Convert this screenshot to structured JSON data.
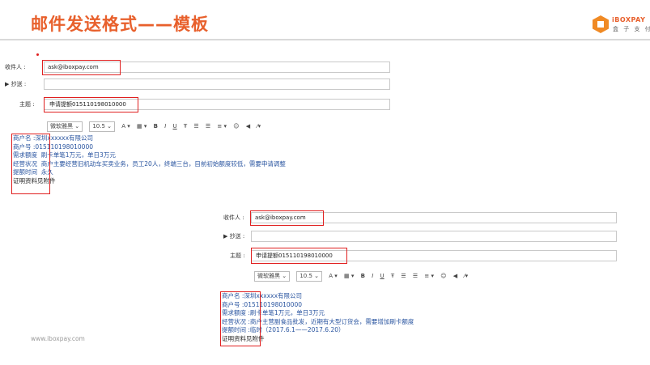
{
  "header": {
    "title": "邮件发送格式——模板",
    "logo_text": "iBOXPAY",
    "logo_sub": "盒 子 支 付"
  },
  "email1": {
    "to_label": "收件人 :",
    "to_value": "ask@iboxpay.com",
    "cc_label": "▶ 抄送 :",
    "subject_label": "主题 :",
    "subject_value": "申请提额015110198010000",
    "toolbar": {
      "font": "微软雅黑",
      "size": "10.5",
      "buttons": [
        "A ▾",
        "▦ ▾",
        "B",
        "I",
        "U",
        "Ŧ",
        "☰",
        "☰",
        "≡ ▾",
        "☺",
        "◀",
        "⁄▾"
      ]
    },
    "body": {
      "lines": [
        {
          "key": "商户名 :",
          "val": "深圳xxxxxx有限公司"
        },
        {
          "key": "商户号 :",
          "val": "015110198010000"
        },
        {
          "key": "需求额度",
          "val": "刷卡单笔1万元，单日3万元"
        },
        {
          "key": "经营状况",
          "val": "商户主要经营旧机动车买卖业务，员工20人，终端三台，目前初始额度较低，需要申请调整"
        },
        {
          "key": "提额时间",
          "val": "永久"
        }
      ],
      "footer": "证明资料见附件"
    }
  },
  "email2": {
    "to_label": "收件人 :",
    "to_value": "ask@iboxpay.com",
    "cc_label": "▶ 抄送 :",
    "subject_label": "主题 :",
    "subject_value": "申请提额015110198010000",
    "toolbar": {
      "font": "微软雅黑",
      "size": "10.5",
      "buttons": [
        "A ▾",
        "▦ ▾",
        "B",
        "I",
        "U",
        "Ŧ",
        "☰",
        "☰",
        "≡ ▾",
        "☺",
        "◀",
        "⁄▾"
      ]
    },
    "body": {
      "lines": [
        {
          "key": "商户名 :",
          "val": "深圳xxxxxx有限公司"
        },
        {
          "key": "商户号 :",
          "val": "015110198010000"
        },
        {
          "key": "需求额度 :",
          "val": "刷卡单笔1万元，单日3万元"
        },
        {
          "key": "经营状况 :",
          "val": "商户主营副食品批发，近期有大型订货会，需要增加刷卡额度"
        },
        {
          "key": "提额时间 :",
          "val": "临时（2017.6.1——2017.6.20）"
        }
      ],
      "footer": "证明资料见附件"
    }
  },
  "footer": {
    "website": "www.iboxpay.com"
  },
  "colors": {
    "accent": "#e8602c",
    "highlight_box": "#e02020",
    "body_text": "#2a55a0"
  }
}
